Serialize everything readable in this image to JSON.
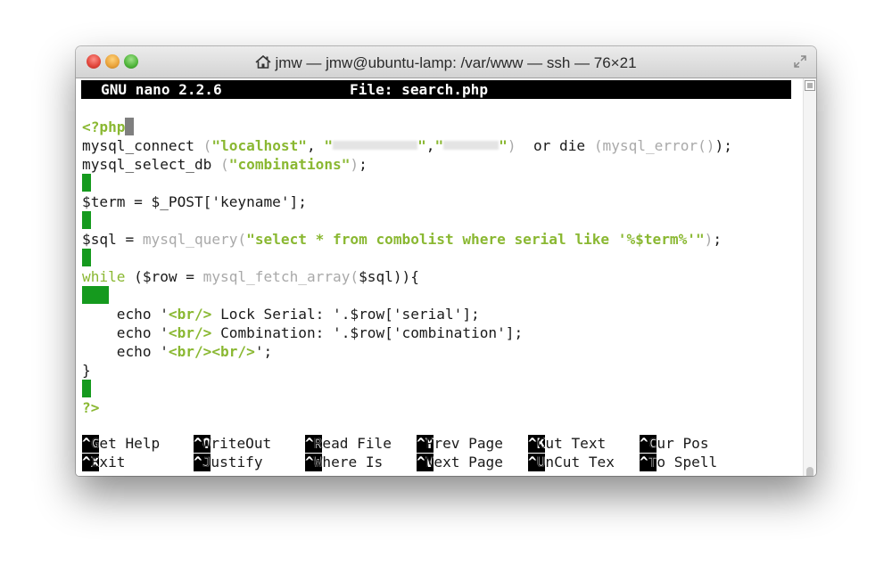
{
  "window": {
    "title": "jmw — jmw@ubuntu-lamp: /var/www — ssh — 76×21"
  },
  "nano": {
    "version": "GNU nano 2.2.6",
    "file": "File: search.php"
  },
  "code": {
    "php_open": "<?php",
    "l2_fn": "mysql_connect",
    "l2_host": "\"localhost\"",
    "l2_or_die": "or die",
    "l2_err": "mysql_error",
    "l3_fn": "mysql_select_db",
    "l3_db": "\"combinations\"",
    "l5": "$term = $_POST['keyname'];",
    "l7_var": "$sql = ",
    "l7_fn": "mysql_query",
    "l7_str": "\"select * from combolist where serial like '%$term%'\"",
    "l9_kw": "while",
    "l9_a": " ($row = ",
    "l9_fn": "mysql_fetch_array",
    "l9_b": "$sql)){",
    "echo": "echo",
    "br_tag": "<br/>",
    "l11_b": " Lock Serial: '.$row['serial'];",
    "l12_b": " Combination: '.$row['combination'];",
    "l13_tags": "<br/><br/>",
    "close_brace": "}",
    "php_close": "?>"
  },
  "shortcuts": {
    "row1": [
      {
        "key": "^G",
        "label": " Get Help"
      },
      {
        "key": "^O",
        "label": " WriteOut"
      },
      {
        "key": "^R",
        "label": " Read File"
      },
      {
        "key": "^Y",
        "label": " Prev Page"
      },
      {
        "key": "^K",
        "label": " Cut Text"
      },
      {
        "key": "^C",
        "label": " Cur Pos"
      }
    ],
    "row2": [
      {
        "key": "^X",
        "label": " Exit"
      },
      {
        "key": "^J",
        "label": " Justify"
      },
      {
        "key": "^W",
        "label": " Where Is"
      },
      {
        "key": "^V",
        "label": " Next Page"
      },
      {
        "key": "^U",
        "label": " UnCut Tex"
      },
      {
        "key": "^T",
        "label": " To Spell"
      }
    ]
  },
  "colors": {
    "syntax_green": "#8ab832",
    "block_green": "#159a1e",
    "function_gray": "#a9a9a9"
  }
}
